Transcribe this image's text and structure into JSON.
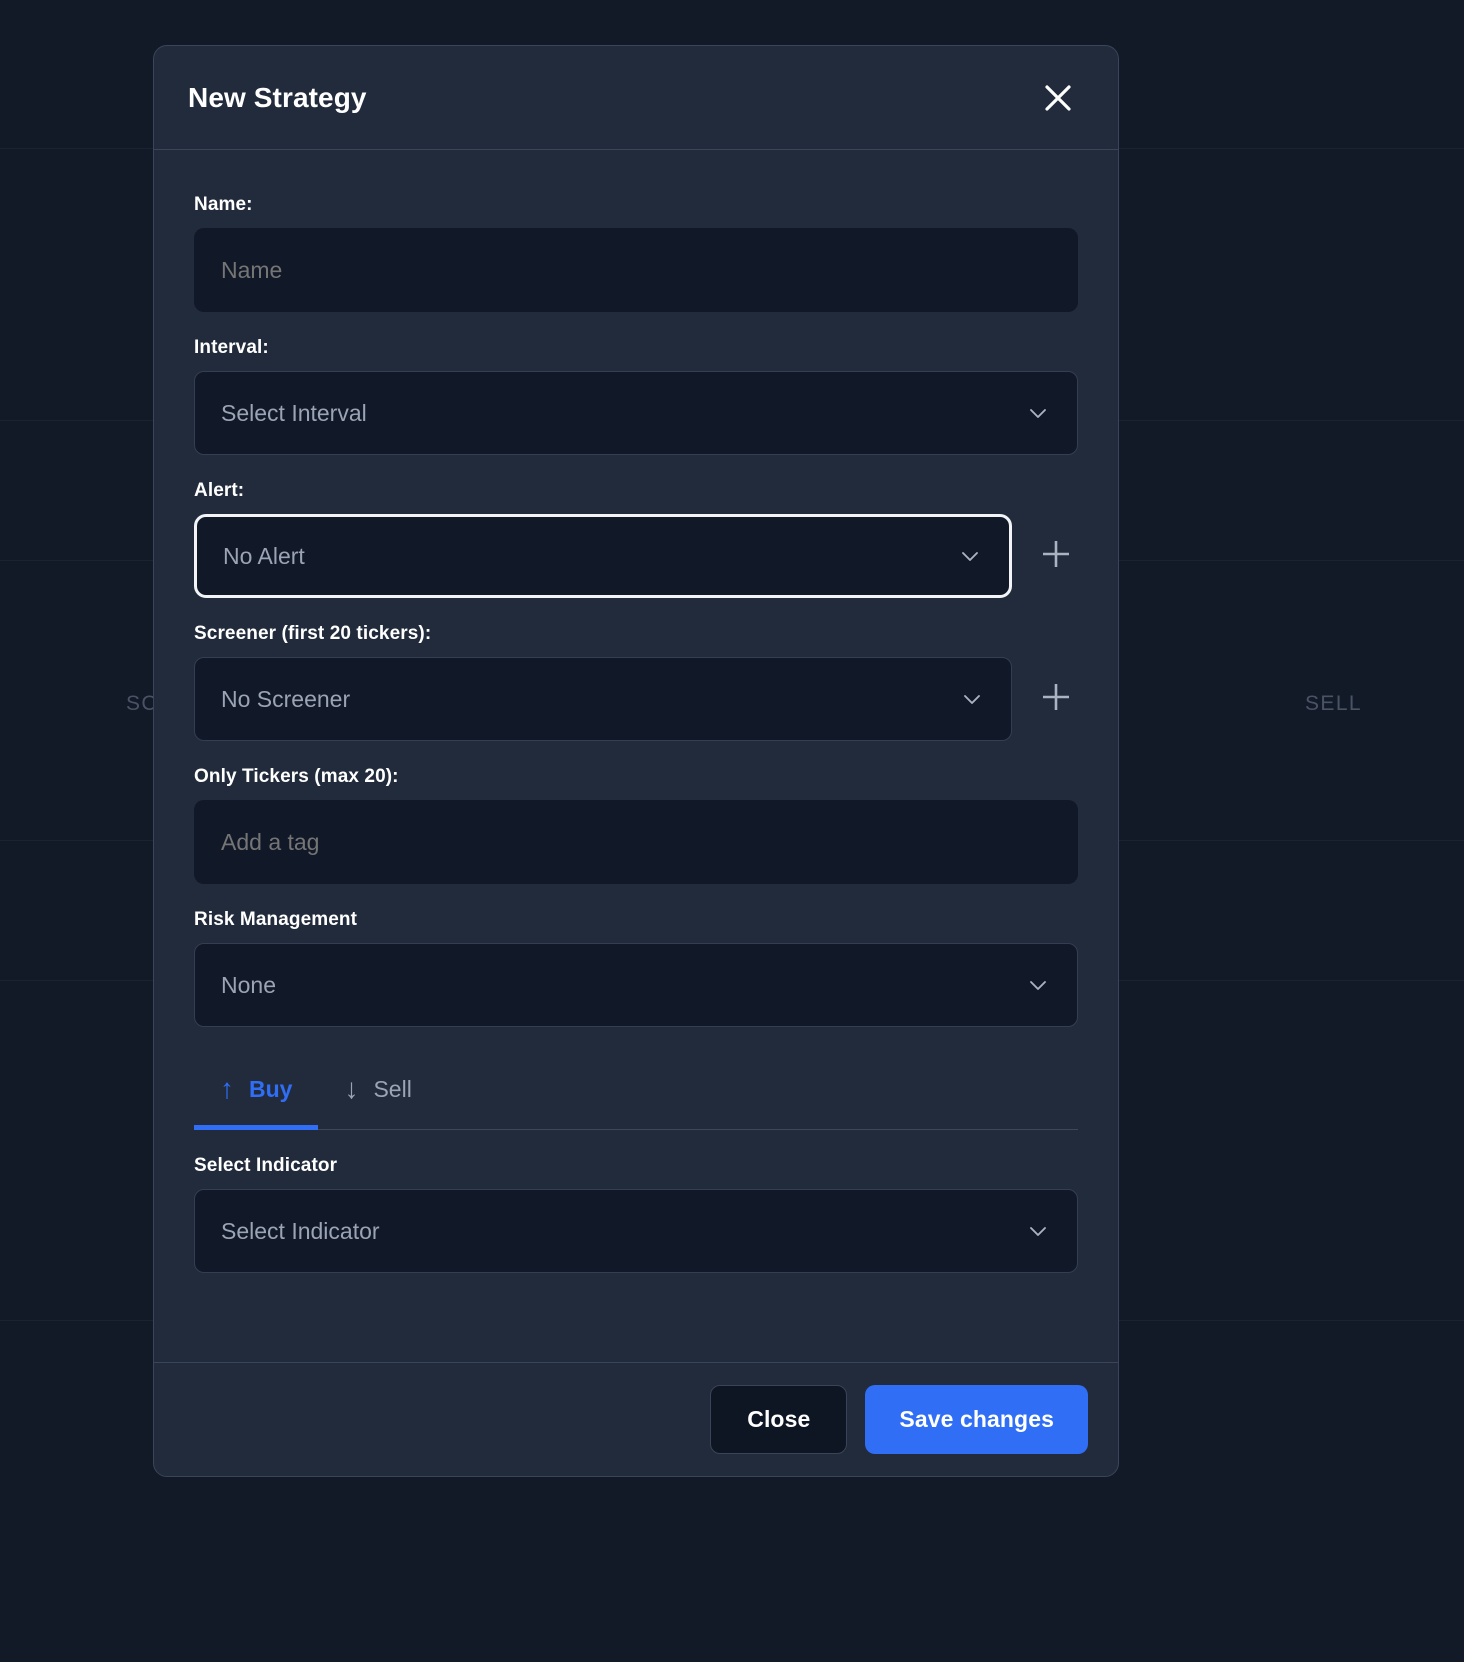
{
  "background": {
    "left_label": "SC",
    "right_label": "SELL"
  },
  "modal": {
    "title": "New Strategy",
    "close_icon": "close-x-icon",
    "fields": {
      "name": {
        "label": "Name:",
        "placeholder": "Name",
        "value": ""
      },
      "interval": {
        "label": "Interval:",
        "selected": "Select Interval",
        "chevron_icon": "chevron-down-icon"
      },
      "alert": {
        "label": "Alert:",
        "selected": "No Alert",
        "focused": true,
        "add_icon": "plus-icon",
        "chevron_icon": "chevron-down-icon"
      },
      "screener": {
        "label": "Screener (first 20 tickers):",
        "selected": "No Screener",
        "add_icon": "plus-icon",
        "chevron_icon": "chevron-down-icon"
      },
      "tickers": {
        "label": "Only Tickers (max 20):",
        "placeholder": "Add a tag",
        "value": ""
      },
      "risk_management": {
        "label": "Risk Management",
        "selected": "None",
        "chevron_icon": "chevron-down-icon"
      },
      "indicator": {
        "label": "Select Indicator",
        "selected": "Select Indicator",
        "chevron_icon": "chevron-down-icon"
      }
    },
    "tabs": [
      {
        "label": "Buy",
        "icon": "arrow-up-icon",
        "glyph": "↑",
        "active": true
      },
      {
        "label": "Sell",
        "icon": "arrow-down-icon",
        "glyph": "↓",
        "active": false
      }
    ],
    "footer": {
      "close_label": "Close",
      "save_label": "Save changes"
    }
  },
  "colors": {
    "accent": "#2f6ef5",
    "modal_bg": "#222b3b",
    "input_bg": "#111827",
    "page_bg": "#131a27",
    "text_primary": "#ffffff",
    "text_muted": "#9aa4b4"
  }
}
